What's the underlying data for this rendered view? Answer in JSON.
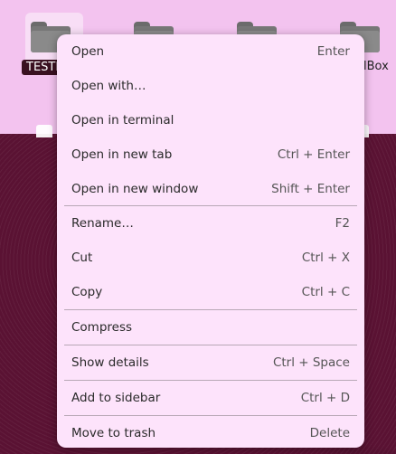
{
  "desktop": {
    "icons": [
      {
        "label": "TESTII",
        "selected": true
      },
      {
        "label": ""
      },
      {
        "label": ""
      },
      {
        "label": "lBox"
      }
    ]
  },
  "context_menu": {
    "items": [
      {
        "label": "Open",
        "shortcut": "Enter"
      },
      {
        "label": "Open with…",
        "shortcut": ""
      },
      {
        "label": "Open in terminal",
        "shortcut": ""
      },
      {
        "label": "Open in new tab",
        "shortcut": "Ctrl + Enter"
      },
      {
        "label": "Open in new window",
        "shortcut": "Shift + Enter"
      },
      {
        "label": "Rename…",
        "shortcut": "F2"
      },
      {
        "label": "Cut",
        "shortcut": "Ctrl + X"
      },
      {
        "label": "Copy",
        "shortcut": "Ctrl + C"
      },
      {
        "label": "Compress",
        "shortcut": ""
      },
      {
        "label": "Show details",
        "shortcut": "Ctrl + Space"
      },
      {
        "label": "Add to sidebar",
        "shortcut": "Ctrl + D"
      },
      {
        "label": "Move to trash",
        "shortcut": "Delete"
      }
    ]
  },
  "colors": {
    "menu_background": "#fde3fb",
    "desktop_background": "#f3c3ef",
    "selection_label": "#3a1121"
  }
}
